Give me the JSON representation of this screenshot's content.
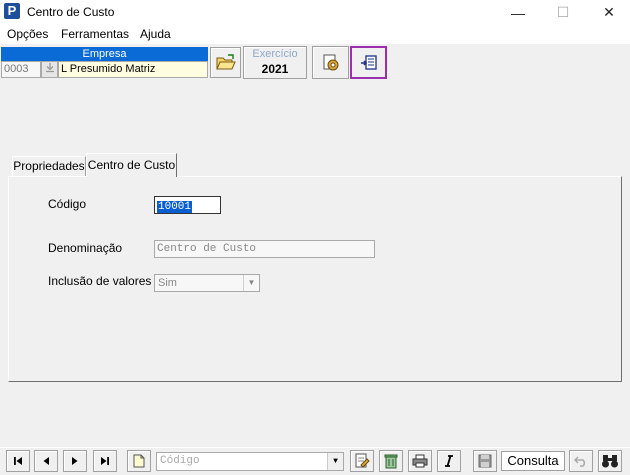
{
  "window": {
    "title": "Centro de Custo",
    "app_icon_letter": "P",
    "minimize_glyph": "—",
    "maximize_glyph": "☐",
    "close_glyph": "✕"
  },
  "menu": {
    "items": [
      "Opções",
      "Ferramentas",
      "Ajuda"
    ]
  },
  "toolbar": {
    "empresa_header": "Empresa",
    "empresa_code": "0003",
    "empresa_name": "L Presumido Matriz",
    "exercicio_label": "Exercício",
    "exercicio_value": "2021",
    "highlight_color": "#9b2fae"
  },
  "tabs": [
    {
      "label": "Propriedades",
      "active": false
    },
    {
      "label": "Centro de Custo",
      "active": true
    }
  ],
  "form": {
    "codigo_label": "Código",
    "codigo_value": "10001",
    "denominacao_label": "Denominação",
    "denominacao_value": "Centro de Custo",
    "inclusao_label": "Inclusão de valores ?",
    "inclusao_value": "Sim"
  },
  "bottom": {
    "search_placeholder": "Código",
    "mode_label": "Consulta"
  }
}
